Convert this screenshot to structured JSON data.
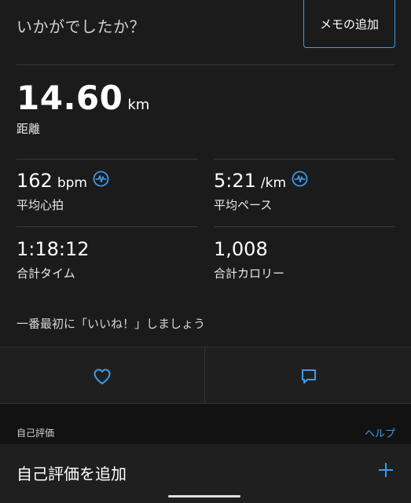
{
  "header": {
    "question": "いかがでしたか？",
    "memo_button": "メモの追加"
  },
  "distance": {
    "value": "14.60",
    "unit": "km",
    "label": "距離"
  },
  "stats": {
    "heart_rate": {
      "value": "162",
      "unit": "bpm",
      "label": "平均心拍"
    },
    "pace": {
      "value": "5:21",
      "unit": "/km",
      "label": "平均ペース"
    },
    "time": {
      "value": "1:18:12",
      "label": "合計タイム"
    },
    "calories": {
      "value": "1,008",
      "label": "合計カロリー"
    }
  },
  "like_prompt": "一番最初に「いいね！」しましょう",
  "self_evaluation": {
    "section_title": "自己評価",
    "help_link": "ヘルプ",
    "add_label": "自己評価を追加"
  },
  "colors": {
    "accent": "#3d9be9",
    "background": "#1b1b1c"
  },
  "icons": [
    "heart-rate-icon",
    "heart-icon",
    "comment-icon",
    "plus-icon"
  ]
}
